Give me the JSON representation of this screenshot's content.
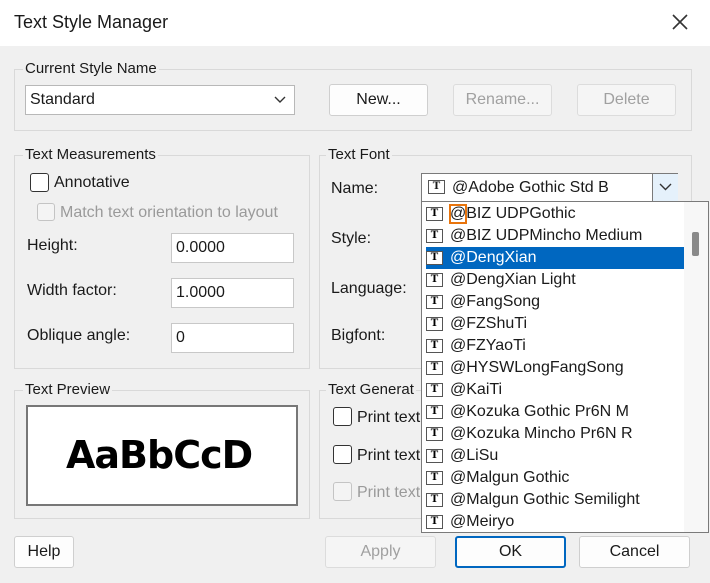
{
  "window": {
    "title": "Text Style Manager"
  },
  "current_style": {
    "legend": "Current Style Name",
    "value": "Standard",
    "new_button": "New...",
    "rename_button": "Rename...",
    "delete_button": "Delete"
  },
  "measurements": {
    "legend": "Text Measurements",
    "annotative_label": "Annotative",
    "match_label": "Match text orientation to layout",
    "height_label": "Height:",
    "height_value": "0.0000",
    "width_label": "Width factor:",
    "width_value": "1.0000",
    "oblique_label": "Oblique angle:",
    "oblique_value": "0"
  },
  "font": {
    "legend": "Text Font",
    "name_label": "Name:",
    "name_value": "@Adobe Gothic Std B",
    "style_label": "Style:",
    "language_label": "Language:",
    "bigfont_label": "Bigfont:"
  },
  "font_list": {
    "selected_index": 2,
    "items": [
      "@BIZ UDPGothic",
      "@BIZ UDPMincho Medium",
      "@DengXian",
      "@DengXian Light",
      "@FangSong",
      "@FZShuTi",
      "@FZYaoTi",
      "@HYSWLongFangSong",
      "@KaiTi",
      "@Kozuka Gothic Pr6N M",
      "@Kozuka Mincho Pr6N R",
      "@LiSu",
      "@Malgun Gothic",
      "@Malgun Gothic Semilight",
      "@Meiryo"
    ],
    "icon_glyph": "T"
  },
  "preview": {
    "legend": "Text Preview",
    "sample": "AaBbCcD"
  },
  "generation": {
    "legend": "Text Generat",
    "opt1": "Print text",
    "opt2": "Print text",
    "opt3": "Print text"
  },
  "footer": {
    "help_button": "Help",
    "apply_button": "Apply",
    "ok_button": "OK",
    "cancel_button": "Cancel"
  },
  "colors": {
    "accent": "#0067c0",
    "highlight_box": "#e8740c"
  }
}
